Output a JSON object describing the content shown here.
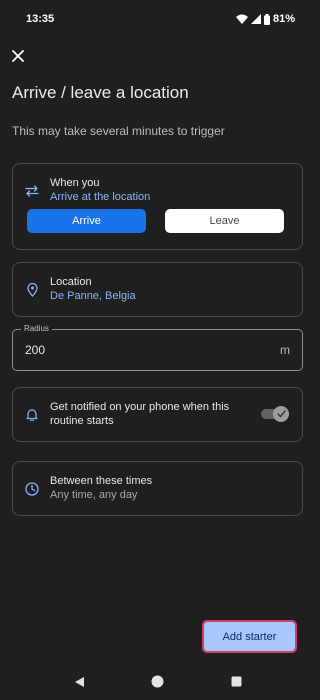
{
  "status_bar": {
    "time": "13:35",
    "battery": "81%"
  },
  "header": {
    "close_icon": "close-icon",
    "title": "Arrive / leave a location",
    "subtitle": "This may take several minutes to trigger"
  },
  "when_card": {
    "icon": "swap-arrows-icon",
    "label": "When you",
    "value": "Arrive at the location",
    "options": [
      "Arrive",
      "Leave"
    ],
    "selected": "Arrive"
  },
  "location_card": {
    "icon": "location-pin-icon",
    "label": "Location",
    "value": "De Panne, Belgia"
  },
  "radius": {
    "label": "Radius",
    "value": "200",
    "unit": "m"
  },
  "notify_card": {
    "icon": "bell-icon",
    "label": "Get notified on your phone when this routine starts",
    "toggle_on": true
  },
  "times_card": {
    "icon": "clock-icon",
    "label": "Between these times",
    "value": "Any time, any day"
  },
  "footer": {
    "add_starter": "Add starter"
  },
  "colors": {
    "accent": "#1a73e8",
    "link": "#8ab4f8",
    "button": "#a8c7fa",
    "background": "#1f1f1f"
  }
}
